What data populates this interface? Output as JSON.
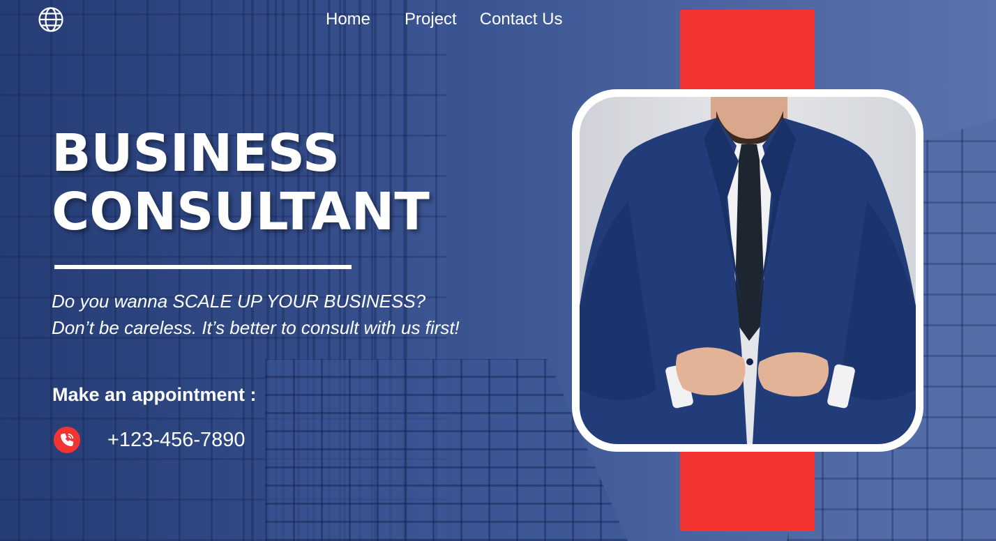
{
  "nav": {
    "items": [
      "Home",
      "Project",
      "Contact Us"
    ]
  },
  "icons": {
    "globe": "globe-icon",
    "phone": "phone-call-icon"
  },
  "hero": {
    "title_line1": "BUSINESS",
    "title_line2": "CONSULTANT",
    "tagline_line1": "Do you wanna SCALE UP YOUR BUSINESS?",
    "tagline_line2": "Don’t be careless. It’s better to consult with us first!",
    "appointment_label": "Make an appointment :",
    "phone": "+123-456-7890"
  },
  "colors": {
    "background": "#3d5791",
    "accent": "#f43433",
    "text": "#ffffff"
  }
}
